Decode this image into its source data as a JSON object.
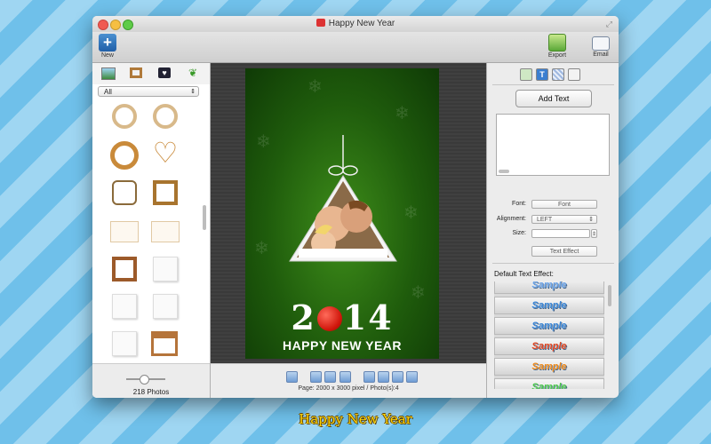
{
  "window": {
    "title": "Happy New Year"
  },
  "toolbar": {
    "new_label": "New",
    "export_label": "Export",
    "email_label": "Email"
  },
  "left": {
    "category_icons": [
      "landscape-icon",
      "frame-icon",
      "heart-icon",
      "leaf-icon"
    ],
    "filter_value": "All",
    "photo_count": "218 Photos",
    "slider_value": 0.45
  },
  "canvas": {
    "year_left": "2",
    "year_right": "14",
    "greeting": "HAPPY NEW YEAR",
    "page_info": "Page: 2000 x 3000 pixel / Photo(s):4"
  },
  "right": {
    "tab_icons": [
      "photo-tab-icon",
      "text-tab-icon",
      "pattern-tab-icon",
      "sticker-tab-icon"
    ],
    "add_text_label": "Add Text",
    "font_label": "Font:",
    "font_button": "Font",
    "alignment_label": "Alignment:",
    "alignment_value": "LEFT",
    "size_label": "Size:",
    "size_value": "",
    "text_effect_button": "Text Effect",
    "default_effect_label": "Default Text Effect:",
    "samples": [
      {
        "text": "Sample",
        "color": "#6aa3e8"
      },
      {
        "text": "Sample",
        "color": "#3a86d6"
      },
      {
        "text": "Sample",
        "color": "#3a86d6"
      },
      {
        "text": "Sample",
        "color": "#e2451f"
      },
      {
        "text": "Sample",
        "color": "#f08a1a"
      },
      {
        "text": "Sample",
        "color": "#4cc84a"
      }
    ]
  },
  "caption": "Happy New Year"
}
